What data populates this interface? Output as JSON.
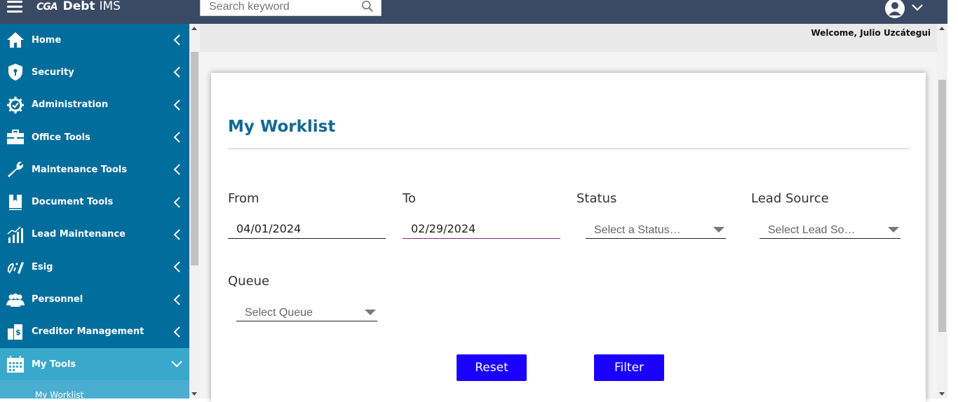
{
  "app": {
    "logo_prefix": "CGA",
    "logo_name": "Debt",
    "logo_suffix": "IMS"
  },
  "search": {
    "placeholder": "Search keyword"
  },
  "header": {
    "welcome": "Welcome, Julio Uzcátegui"
  },
  "sidebar": {
    "items": [
      {
        "label": "Home",
        "icon": "home-icon"
      },
      {
        "label": "Security",
        "icon": "shield-icon"
      },
      {
        "label": "Administration",
        "icon": "gear-icon"
      },
      {
        "label": "Office Tools",
        "icon": "briefcase-icon"
      },
      {
        "label": "Maintenance Tools",
        "icon": "wrench-icon"
      },
      {
        "label": "Document Tools",
        "icon": "book-icon"
      },
      {
        "label": "Lead Maintenance",
        "icon": "chart-icon"
      },
      {
        "label": "Esig",
        "icon": "signature-icon"
      },
      {
        "label": "Personnel",
        "icon": "users-icon"
      },
      {
        "label": "Creditor Management",
        "icon": "building-dollar-icon"
      },
      {
        "label": "My Tools",
        "icon": "calendar-icon"
      }
    ],
    "subitems": [
      {
        "label": "My Worklist"
      }
    ]
  },
  "page": {
    "title": "My Worklist",
    "from_label": "From",
    "from_value": "04/01/2024",
    "to_label": "To",
    "to_value": "02/29/2024",
    "status_label": "Status",
    "status_placeholder": "Select a Status…",
    "lead_source_label": "Lead Source",
    "lead_source_placeholder": "Select Lead So…",
    "queue_label": "Queue",
    "queue_placeholder": "Select Queue",
    "reset_label": "Reset",
    "filter_label": "Filter"
  },
  "colors": {
    "topbar": "#3b4a64",
    "sidebar": "#006d9c",
    "sidebar_active": "#39a9cb",
    "title": "#0e6a92",
    "button": "#1a00ff"
  }
}
